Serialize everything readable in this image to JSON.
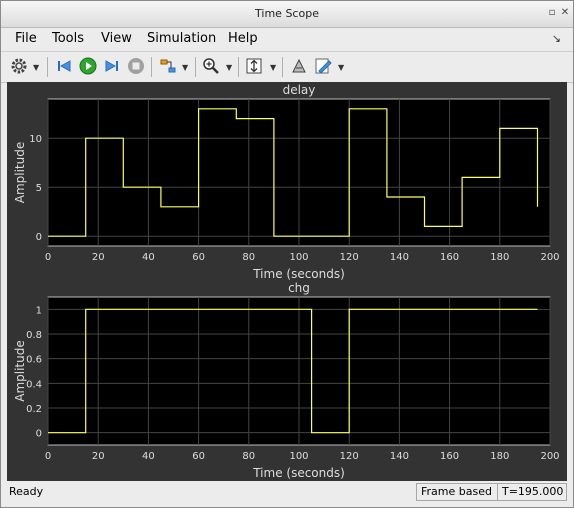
{
  "window": {
    "title": "Time Scope"
  },
  "menu": [
    "File",
    "Tools",
    "View",
    "Simulation",
    "Help"
  ],
  "toolbar": {
    "icons": [
      "gear-icon",
      "step-back-icon",
      "run-icon",
      "step-forward-icon",
      "stop-icon",
      "highlight-signal-icon",
      "zoom-in-icon",
      "autoscale-icon",
      "restore-view-icon",
      "edit-style-icon"
    ]
  },
  "plots": [
    {
      "title": "delay",
      "ylabel": "Amplitude",
      "xlabel": "Time (seconds)",
      "xticks": [
        "0",
        "20",
        "40",
        "60",
        "80",
        "100",
        "120",
        "140",
        "160",
        "180",
        "200"
      ],
      "yticks": [
        "0",
        "5",
        "10"
      ],
      "xlim": [
        0,
        200
      ],
      "ylim": [
        -1,
        14
      ]
    },
    {
      "title": "chg",
      "ylabel": "Amplitude",
      "xlabel": "Time (seconds)",
      "xticks": [
        "0",
        "20",
        "40",
        "60",
        "80",
        "100",
        "120",
        "140",
        "160",
        "180",
        "200"
      ],
      "yticks": [
        "0",
        "0.2",
        "0.4",
        "0.6",
        "0.8",
        "1"
      ],
      "xlim": [
        0,
        200
      ],
      "ylim": [
        -0.1,
        1.1
      ]
    }
  ],
  "chart_data": [
    {
      "type": "line",
      "title": "delay",
      "xlabel": "Time (seconds)",
      "ylabel": "Amplitude",
      "xlim": [
        0,
        200
      ],
      "ylim": [
        -1,
        14
      ],
      "grid": true,
      "color": "#ffff55",
      "x": [
        0,
        15,
        15,
        30,
        30,
        45,
        45,
        60,
        60,
        75,
        75,
        90,
        90,
        120,
        120,
        135,
        135,
        150,
        150,
        165,
        165,
        180,
        180,
        195,
        195
      ],
      "y": [
        0,
        0,
        10,
        10,
        5,
        5,
        3,
        3,
        13,
        13,
        12,
        12,
        0,
        0,
        13,
        13,
        4,
        4,
        1,
        1,
        6,
        6,
        11,
        11,
        3
      ]
    },
    {
      "type": "line",
      "title": "chg",
      "xlabel": "Time (seconds)",
      "ylabel": "Amplitude",
      "xlim": [
        0,
        200
      ],
      "ylim": [
        -0.1,
        1.1
      ],
      "grid": true,
      "color": "#ffff55",
      "x": [
        0,
        15,
        15,
        105,
        105,
        120,
        120,
        195
      ],
      "y": [
        0,
        0,
        1,
        1,
        0,
        0,
        1,
        1
      ]
    }
  ],
  "status": {
    "left": "Ready",
    "mode": "Frame based",
    "time": "T=195.000"
  }
}
